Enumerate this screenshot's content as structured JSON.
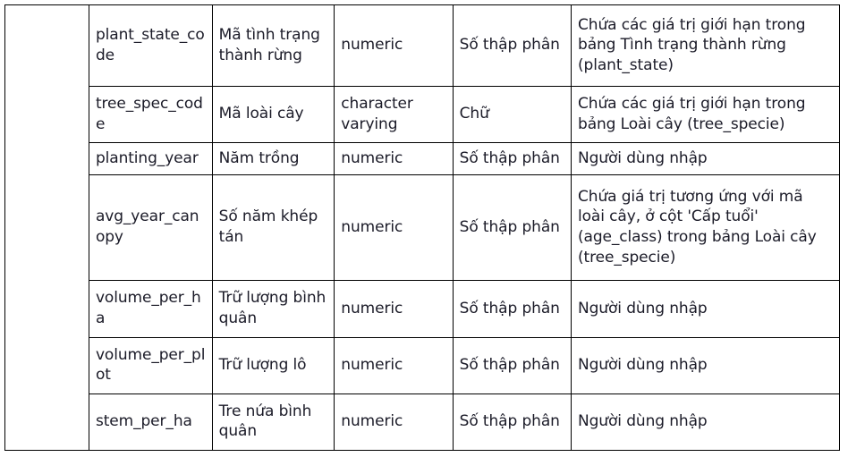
{
  "table": {
    "name": "database-field-description-table",
    "leading_column_empty": true,
    "columns": [
      {
        "key": "spacer",
        "label": ""
      },
      {
        "key": "field_name",
        "label": ""
      },
      {
        "key": "vn_name",
        "label": ""
      },
      {
        "key": "data_type",
        "label": ""
      },
      {
        "key": "vn_type",
        "label": ""
      },
      {
        "key": "description",
        "label": ""
      }
    ],
    "rows": [
      {
        "field_name": "plant_state_code",
        "vn_name": "Mã tình trạng thành rừng",
        "data_type": "numeric",
        "vn_type": "Số thập phân",
        "description": "Chứa các giá trị giới hạn trong bảng Tình trạng thành rừng (plant_state)"
      },
      {
        "field_name": "tree_spec_code",
        "vn_name": "Mã loài cây",
        "data_type": "character varying",
        "vn_type": "Chữ",
        "description": "Chứa các giá trị giới hạn trong bảng Loài cây (tree_specie)"
      },
      {
        "field_name": "planting_year",
        "vn_name": "Năm trồng",
        "data_type": "numeric",
        "vn_type": "Số thập phân",
        "description": "Người dùng nhập"
      },
      {
        "field_name": "avg_year_canopy",
        "vn_name": "Số năm khép tán",
        "data_type": "numeric",
        "vn_type": "Số thập phân",
        "description": "Chứa giá trị tương ứng với mã loài cây, ở cột 'Cấp tuổi' (age_class) trong bảng Loài cây (tree_specie)"
      },
      {
        "field_name": "volume_per_ha",
        "vn_name": "Trữ lượng bình quân",
        "data_type": "numeric",
        "vn_type": "Số thập phân",
        "description": "Người dùng nhập"
      },
      {
        "field_name": "volume_per_plot",
        "vn_name": "Trữ lượng lô",
        "data_type": "numeric",
        "vn_type": "Số thập phân",
        "description": "Người dùng nhập"
      },
      {
        "field_name": "stem_per_ha",
        "vn_name": "Tre nứa bình quân",
        "data_type": "numeric",
        "vn_type": "Số thập phân",
        "description": "Người dùng nhập"
      }
    ]
  },
  "style": {
    "border_color": "#000000",
    "text_color": "#1b1b28",
    "background": "#ffffff"
  }
}
